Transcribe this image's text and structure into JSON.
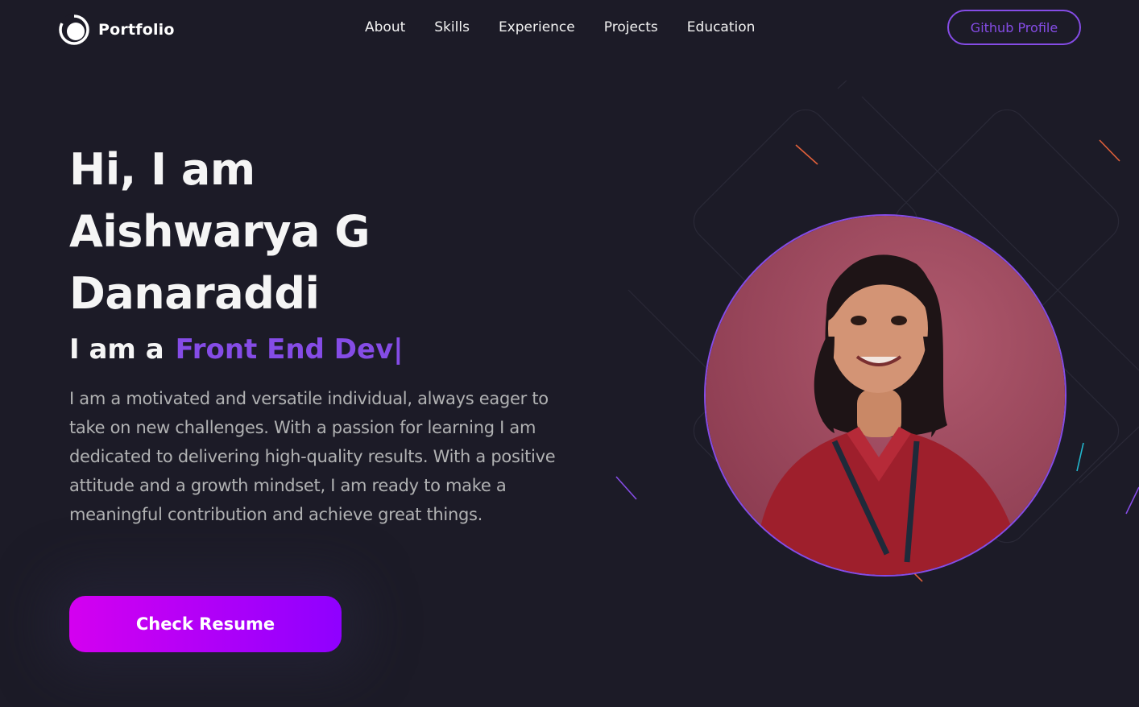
{
  "navbar": {
    "logo_text": "Portfolio",
    "logo_icon": "portfolio-logo-icon",
    "links": [
      "About",
      "Skills",
      "Experience",
      "Projects",
      "Education"
    ],
    "github_label": "Github Profile"
  },
  "hero": {
    "greeting": "Hi, I am",
    "name_line1": "Aishwarya G",
    "name_line2": "Danaraddi",
    "role_prefix": "I am a",
    "role_typed": "Front End Dev",
    "cursor": "|",
    "description": "I am a motivated and versatile individual, always eager to take on new challenges. With a passion for learning I am dedicated to delivering high-quality results. With a positive attitude and a growth mindset, I am ready to make a meaningful contribution and achieve great things.",
    "resume_label": "Check Resume",
    "profile_image": "profile-photo"
  },
  "colors": {
    "background": "#1c1b27",
    "accent": "#854ce6",
    "text_primary": "#f2f2f2",
    "text_secondary": "#b1b2b3",
    "button_gradient_start": "#d400f0",
    "button_gradient_end": "#8f00ff"
  }
}
